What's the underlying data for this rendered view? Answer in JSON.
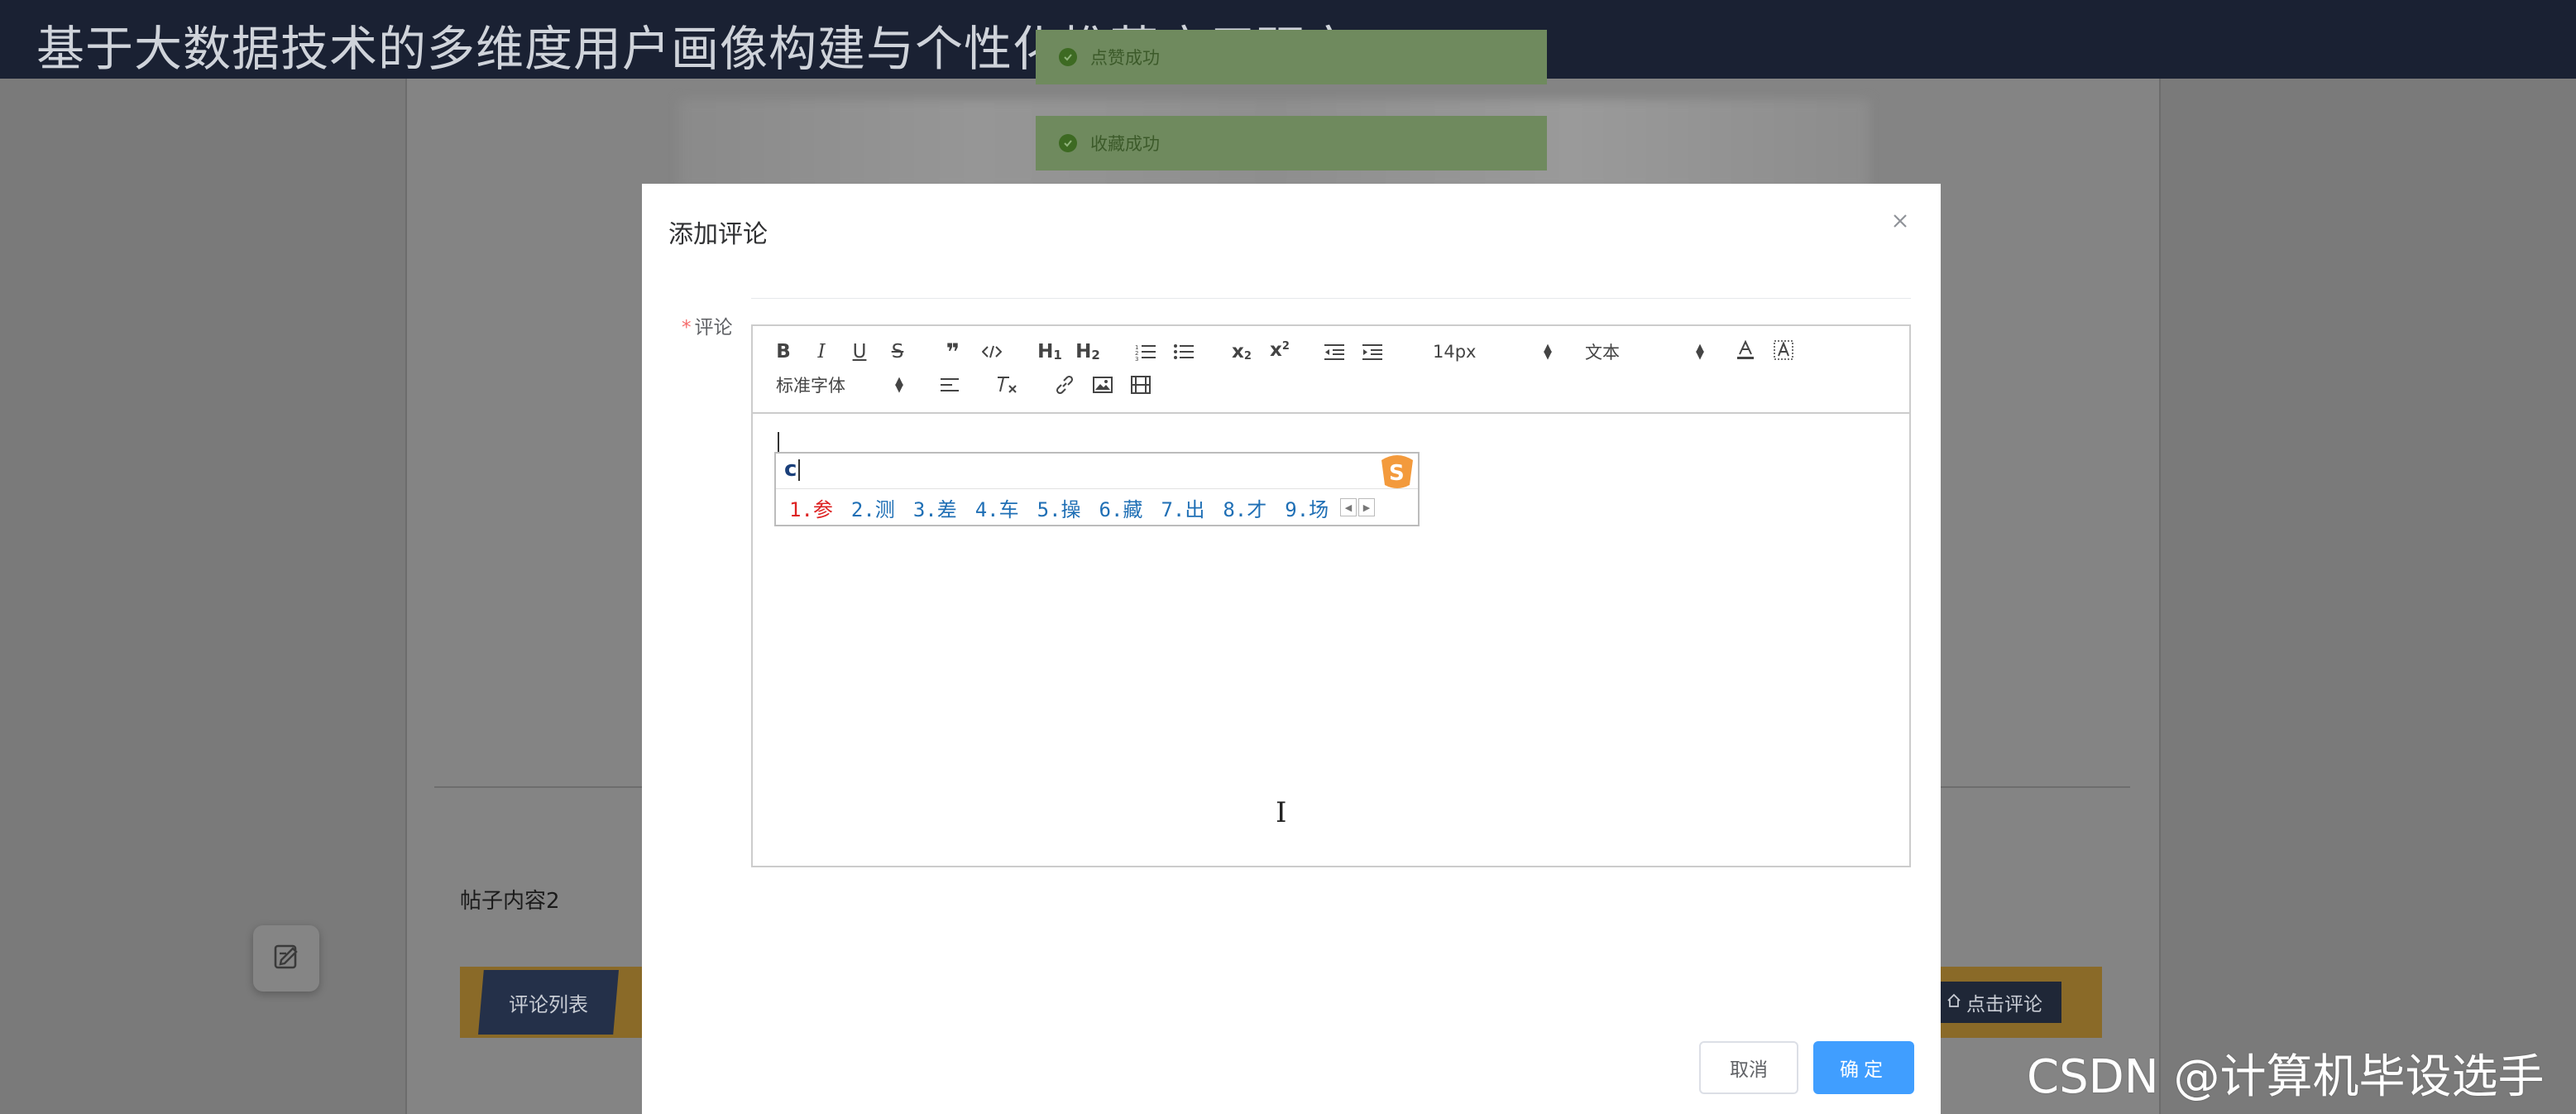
{
  "site": {
    "title": "基于大数据技术的多维度用户画像构建与个性化推荐应用研究"
  },
  "toasts": [
    {
      "text": "点赞成功"
    },
    {
      "text": "收藏成功"
    }
  ],
  "post": {
    "content": "帖子内容2"
  },
  "tabs": {
    "comment_list": "评论列表",
    "click_comment": "点击评论"
  },
  "modal": {
    "title": "添加评论",
    "field_label": "评论",
    "toolbar": {
      "font_size": "14px",
      "header_select": "文本",
      "font_family": "标准字体"
    },
    "ime": {
      "input": "c",
      "candidates": [
        "1.参",
        "2.测",
        "3.差",
        "4.车",
        "5.操",
        "6.藏",
        "7.出",
        "8.才",
        "9.场"
      ]
    },
    "cancel_label": "取消",
    "ok_label": "确定"
  },
  "watermark": "CSDN @计算机毕设选手",
  "colors": {
    "primary": "#409eff",
    "required": "#f56c6c",
    "header_bg": "#1a2133",
    "gold": "#c89b3c"
  }
}
